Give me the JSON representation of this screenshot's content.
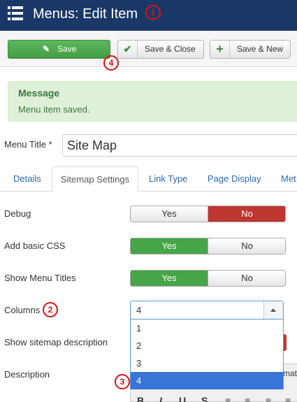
{
  "header": {
    "title": "Menus: Edit Item"
  },
  "badges": {
    "b1": "1",
    "b2": "2",
    "b3": "3",
    "b4": "4"
  },
  "toolbar": {
    "save_label": "Save",
    "save_close_label": "Save & Close",
    "save_new_label": "Save & New"
  },
  "message": {
    "heading": "Message",
    "body": "Menu item saved."
  },
  "menu_title": {
    "label": "Menu Title *",
    "value": "Site Map"
  },
  "tabs": [
    {
      "label": "Details"
    },
    {
      "label": "Sitemap Settings"
    },
    {
      "label": "Link Type"
    },
    {
      "label": "Page Display"
    },
    {
      "label": "Met"
    }
  ],
  "fields": {
    "debug": {
      "label": "Debug",
      "yes": "Yes",
      "no": "No"
    },
    "css": {
      "label": "Add basic CSS",
      "yes": "Yes",
      "no": "No"
    },
    "titles": {
      "label": "Show Menu Titles",
      "yes": "Yes",
      "no": "No"
    },
    "columns": {
      "label": "Columns",
      "value": "4",
      "options": [
        "1",
        "2",
        "3",
        "4"
      ]
    },
    "show_desc": {
      "label": "Show sitemap description"
    },
    "description": {
      "label": "Description"
    }
  },
  "editor": {
    "tab_label": "mat",
    "tools": [
      "B",
      "I",
      "U",
      "S",
      "≡",
      "≡",
      "≡",
      "≡"
    ]
  },
  "colors": {
    "header": "#1a3867",
    "green": "#46a546",
    "red": "#bd362f",
    "accent": "#3875d7"
  }
}
